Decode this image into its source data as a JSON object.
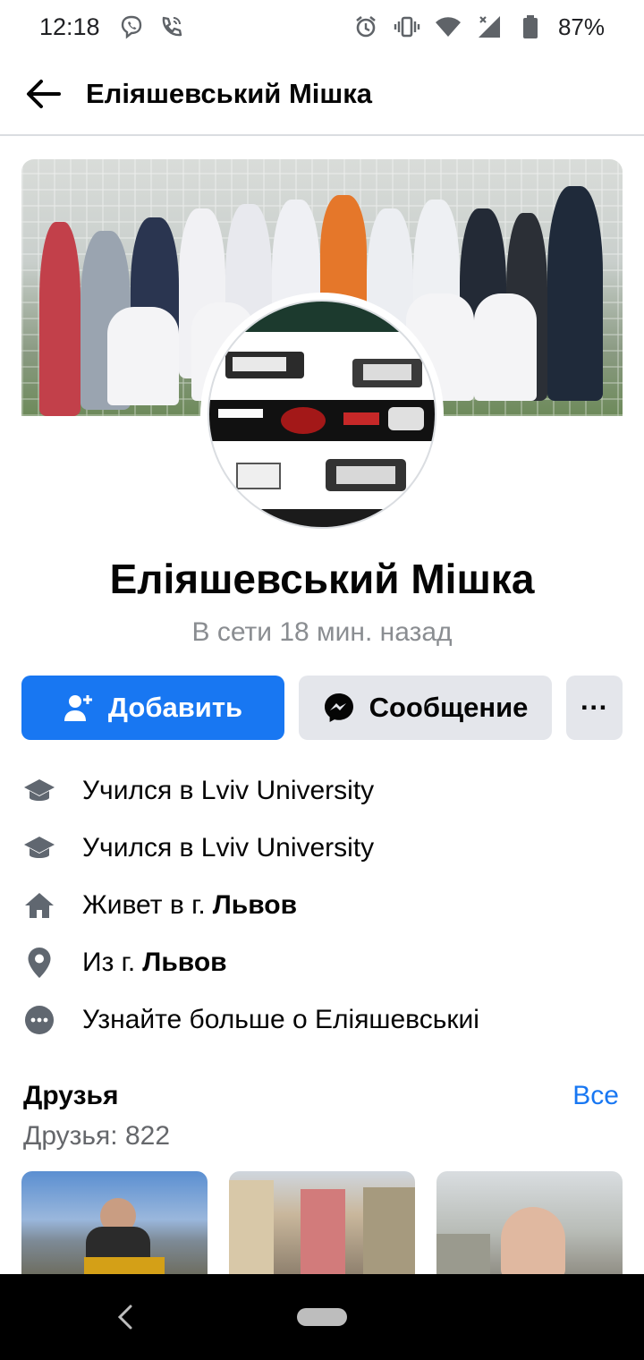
{
  "status_bar": {
    "time": "12:18",
    "battery": "87%",
    "icons": [
      "viber-icon",
      "phone-icon",
      "alarm-icon",
      "vibrate-icon",
      "wifi-icon",
      "signal-icon",
      "battery-icon"
    ]
  },
  "header": {
    "title": "Еліяшевський Мішка"
  },
  "profile": {
    "name": "Еліяшевський Мішка",
    "status": "В сети 18 мин. назад"
  },
  "actions": {
    "add_label": "Добавить",
    "message_label": "Сообщение",
    "more_label": "···"
  },
  "info": [
    {
      "icon": "education-icon",
      "text": "Учился в Lviv University",
      "bold": ""
    },
    {
      "icon": "education-icon",
      "text": "Учился в Lviv University",
      "bold": ""
    },
    {
      "icon": "home-icon",
      "text": "Живет в г.",
      "bold": "Львов"
    },
    {
      "icon": "location-icon",
      "text": "Из г.",
      "bold": "Львов"
    },
    {
      "icon": "more-circle-icon",
      "text": "Узнайте больше о Еліяшевськиі",
      "bold": ""
    }
  ],
  "friends": {
    "title": "Друзья",
    "see_all": "Все",
    "count": "Друзья: 822"
  },
  "colors": {
    "accent": "#1877f2",
    "button_gray": "#e4e6eb",
    "secondary_text": "#65676b"
  }
}
